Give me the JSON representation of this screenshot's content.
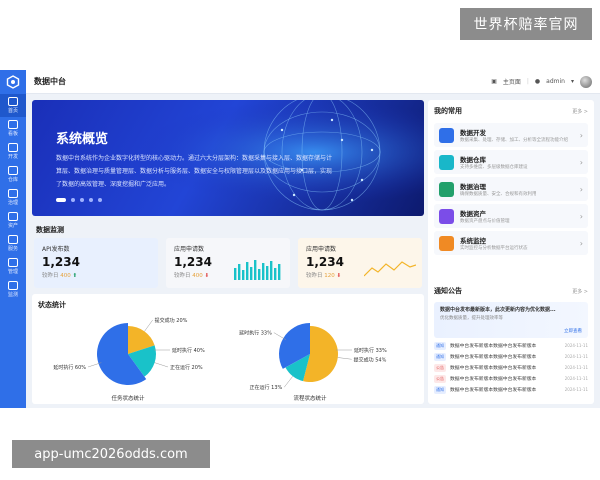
{
  "watermark_top": "世界杯赔率官网",
  "watermark_bottom": "app-umc2026odds.com",
  "app_title": "数据中台",
  "topbar": {
    "home": "主页面",
    "user": "admin"
  },
  "sidebar": [
    {
      "label": "首页",
      "active": true
    },
    {
      "label": "看板"
    },
    {
      "label": "开发"
    },
    {
      "label": "仓库"
    },
    {
      "label": "治理"
    },
    {
      "label": "资产"
    },
    {
      "label": "服务"
    },
    {
      "label": "管理"
    },
    {
      "label": "监测"
    }
  ],
  "hero": {
    "title": "系统概览",
    "text": "数据中台系统作为企业数字化转型的核心驱动力。通过六大分层架构：数据采集与接入层、数据存储与计算层、数据治理与质量管理层、数据分析与服务层、数据安全与权限管理层以及数据应用与接口层，实现了数据的高效管理、深度挖掘和广泛应用。"
  },
  "metrics_title": "数据监测",
  "metrics": [
    {
      "title": "API发布数",
      "value": "1,234",
      "sub_label": "较昨日",
      "sub_num": "400",
      "trend": "up"
    },
    {
      "title": "应用申请数",
      "value": "1,234",
      "sub_label": "较昨日",
      "sub_num": "400",
      "trend": "down"
    },
    {
      "title": "应用申请数",
      "value": "1,234",
      "sub_label": "较昨日",
      "sub_num": "120",
      "trend": "down"
    }
  ],
  "status_title": "状态统计",
  "pies": [
    {
      "caption": "任务状态统计",
      "slices": [
        {
          "label": "提交成功",
          "value": 20,
          "color": "#f3b428"
        },
        {
          "label": "正在运行",
          "value": 20,
          "color": "#19c2c9"
        },
        {
          "label": "延时执行",
          "value": 60,
          "color": "#2f6fe8"
        }
      ],
      "extra_label": {
        "label": "延时执行",
        "value": "40%"
      }
    },
    {
      "caption": "流程状态统计",
      "slices": [
        {
          "label": "提交成功",
          "value": 54,
          "color": "#f3b428"
        },
        {
          "label": "正在运行",
          "value": 13,
          "color": "#19c2c9"
        },
        {
          "label": "延时执行",
          "value": 33,
          "color": "#2f6fe8"
        }
      ],
      "extra_label": {
        "label": "延时执行",
        "value": "33%"
      }
    }
  ],
  "favorites": {
    "title": "我的常用",
    "more": "更多 >",
    "items": [
      {
        "name": "数据开发",
        "desc": "数据采集、处理、存储、加工、分析等全流程功能介绍",
        "color": "#2f6fe8"
      },
      {
        "name": "数据仓库",
        "desc": "支持多维度、多层级数据仓库建设",
        "color": "#19b7c9"
      },
      {
        "name": "数据治理",
        "desc": "确保数据质量、安全、合规和有效利用",
        "color": "#22a06b"
      },
      {
        "name": "数据资产",
        "desc": "数据资产盘点与价值管理",
        "color": "#7b4de8"
      },
      {
        "name": "系统监控",
        "desc": "实时监控与分析数据平台运行状态",
        "color": "#f08a24"
      }
    ]
  },
  "notice": {
    "title": "通知公告",
    "more": "更多 >",
    "hero_title": "数据中台发布最新版本，此次更新内容为优化数据...",
    "hero_text": "优化数据质量，提升处理效率等",
    "hero_link": "立即查看",
    "rows": [
      {
        "tag": "通知",
        "tag_color": "blue",
        "text": "数据中台发布新版本数据中台发布新版本",
        "date": "2024-11-11"
      },
      {
        "tag": "通知",
        "tag_color": "blue",
        "text": "数据中台发布新版本数据中台发布新版本",
        "date": "2024-11-11"
      },
      {
        "tag": "公告",
        "tag_color": "red",
        "text": "数据中台发布新版本数据中台发布新版本",
        "date": "2024-11-11"
      },
      {
        "tag": "公告",
        "tag_color": "red",
        "text": "数据中台发布新版本数据中台发布新版本",
        "date": "2024-11-11"
      },
      {
        "tag": "通知",
        "tag_color": "blue",
        "text": "数据中台发布新版本数据中台发布新版本",
        "date": "2024-11-11"
      }
    ]
  }
}
